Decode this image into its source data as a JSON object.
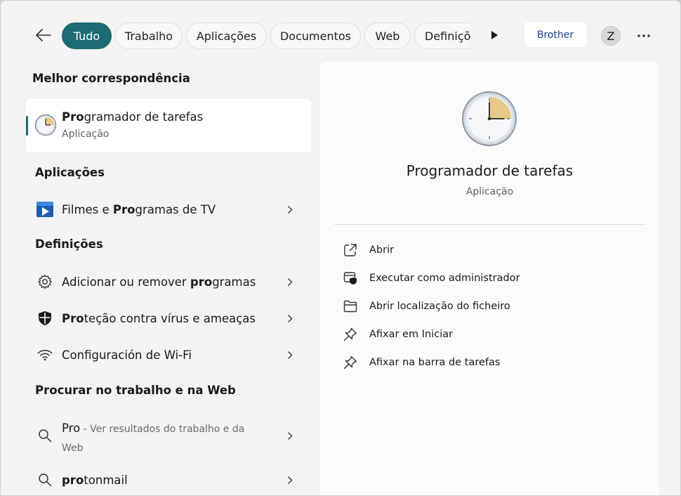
{
  "header": {
    "tabs": [
      {
        "label": "Tudo",
        "active": true
      },
      {
        "label": "Trabalho"
      },
      {
        "label": "Aplicações"
      },
      {
        "label": "Documentos"
      },
      {
        "label": "Web"
      },
      {
        "label": "Definiçõ"
      }
    ],
    "org_label": "Brother",
    "avatar_initial": "Z",
    "icons": {
      "back": "back-arrow-icon",
      "more_tabs": "play-right-icon",
      "options": "more-dots-icon"
    }
  },
  "left": {
    "best_match_title": "Melhor correspondência",
    "best_match": {
      "title_bold": "Pro",
      "title_rest": "gramador de tarefas",
      "subtitle": "Aplicação",
      "icon": "clock-icon"
    },
    "apps_title": "Aplicações",
    "apps": [
      {
        "before": "Filmes e ",
        "bold": "Pro",
        "after": "gramas de TV",
        "icon": "movies-tv-icon"
      }
    ],
    "settings_title": "Definições",
    "settings": [
      {
        "before": "Adicionar ou remover ",
        "bold": "pro",
        "after": "gramas",
        "icon": "gear-icon"
      },
      {
        "before": "",
        "bold": "Pro",
        "after": "teção contra vírus e ameaças",
        "icon": "shield-icon"
      },
      {
        "before": "Configuración de Wi-Fi",
        "bold": "",
        "after": "",
        "icon": "wifi-icon"
      }
    ],
    "web_title": "Procurar no trabalho e na Web",
    "web": [
      {
        "main": "Pro",
        "suffix": " - Ver resultados do trabalho e da Web",
        "icon": "search-icon"
      },
      {
        "before": "",
        "bold": "pro",
        "after": "tonmail",
        "icon": "search-icon"
      }
    ]
  },
  "panel": {
    "title": "Programador de tarefas",
    "subtitle": "Aplicação",
    "actions": [
      {
        "label": "Abrir",
        "icon": "open-external-icon"
      },
      {
        "label": "Executar como administrador",
        "icon": "run-as-admin-icon"
      },
      {
        "label": "Abrir localização do ficheiro",
        "icon": "folder-icon"
      },
      {
        "label": "Afixar em Iniciar",
        "icon": "pin-icon"
      },
      {
        "label": "Afixar na barra de tarefas",
        "icon": "pin-icon"
      }
    ],
    "colors": {
      "accent": "#1d6b73",
      "clock_face": "#e9c98a"
    }
  }
}
